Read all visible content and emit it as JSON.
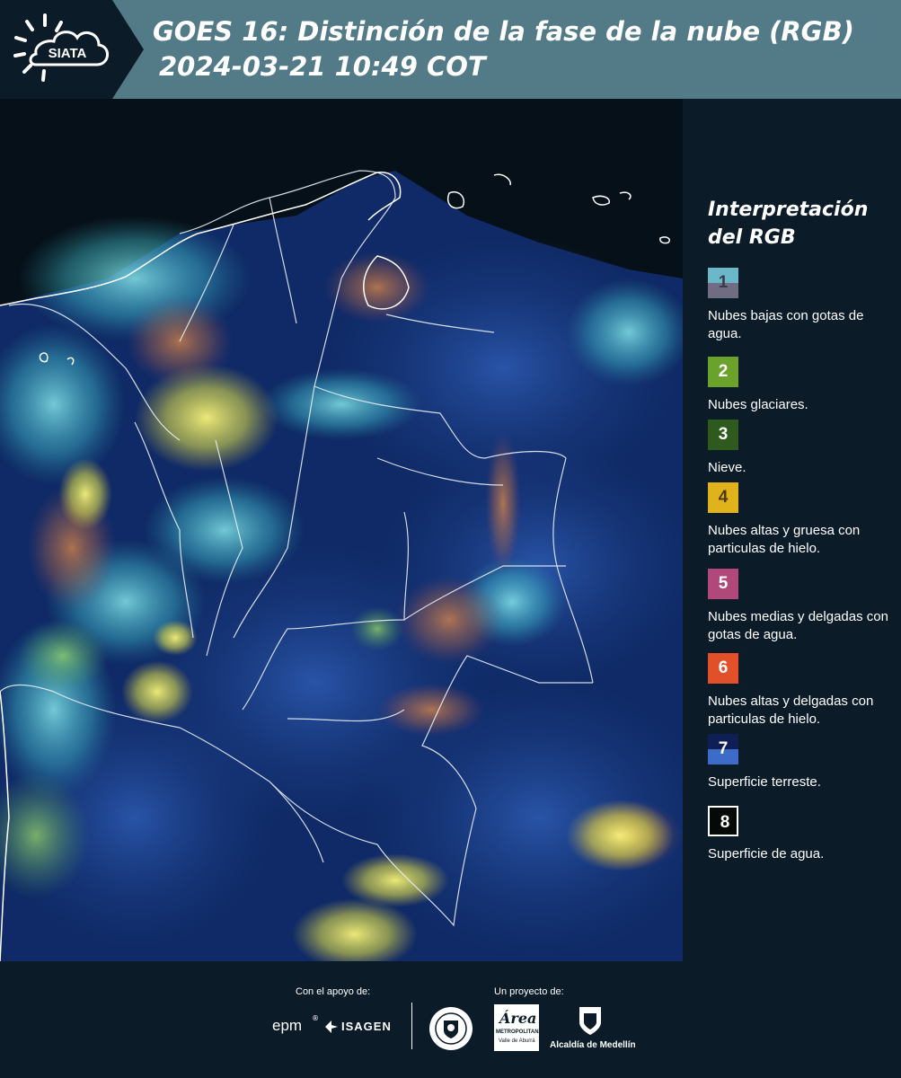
{
  "header": {
    "logo_text": "SIATA",
    "title": "GOES 16: Distinción de la fase de la nube (RGB)",
    "subtitle": "2024-03-21 10:49 COT",
    "background_color": "#527a87"
  },
  "legend": {
    "title": "Interpretación del RGB",
    "items": [
      {
        "number": "1",
        "label": "Nubes bajas con gotas de agua.",
        "color_top": "#6ab8c8",
        "color_bottom": "#706c82",
        "text_color": "#3a3a4a"
      },
      {
        "number": "2",
        "label": "Nubes glaciares.",
        "color": "#6aa22c",
        "text_color": "#ffffff"
      },
      {
        "number": "3",
        "label": "Nieve.",
        "color": "#2f5a1d",
        "text_color": "#ffffff"
      },
      {
        "number": "4",
        "label": "Nubes altas y gruesa con particulas de hielo.",
        "color": "#e0b21c",
        "text_color": "#4a3a10"
      },
      {
        "number": "5",
        "label": "Nubes medias y delgadas con gotas de agua.",
        "color": "#b0487a",
        "text_color": "#ffffff"
      },
      {
        "number": "6",
        "label": "Nubes altas y delgadas con particulas de hielo.",
        "color": "#e2502a",
        "text_color": "#ffffff"
      },
      {
        "number": "7",
        "label": "Superficie terreste.",
        "color_top": "#0f1f55",
        "color_bottom": "#3d6cc8",
        "text_color": "#ffffff"
      },
      {
        "number": "8",
        "label": "Superficie de agua.",
        "color": "#050a06",
        "text_color": "#ffffff",
        "border": "#ffffff"
      }
    ]
  },
  "footer": {
    "support_label": "Con el apoyo de:",
    "project_label": "Un proyecto de:",
    "sponsors": [
      "epm",
      "ISAGEN"
    ],
    "metro_text": "METROPOLITANA",
    "metro_sub": "Valle de Aburrá",
    "metro_script": "Área",
    "alcaldia_text": "Alcaldía de Medellín"
  }
}
